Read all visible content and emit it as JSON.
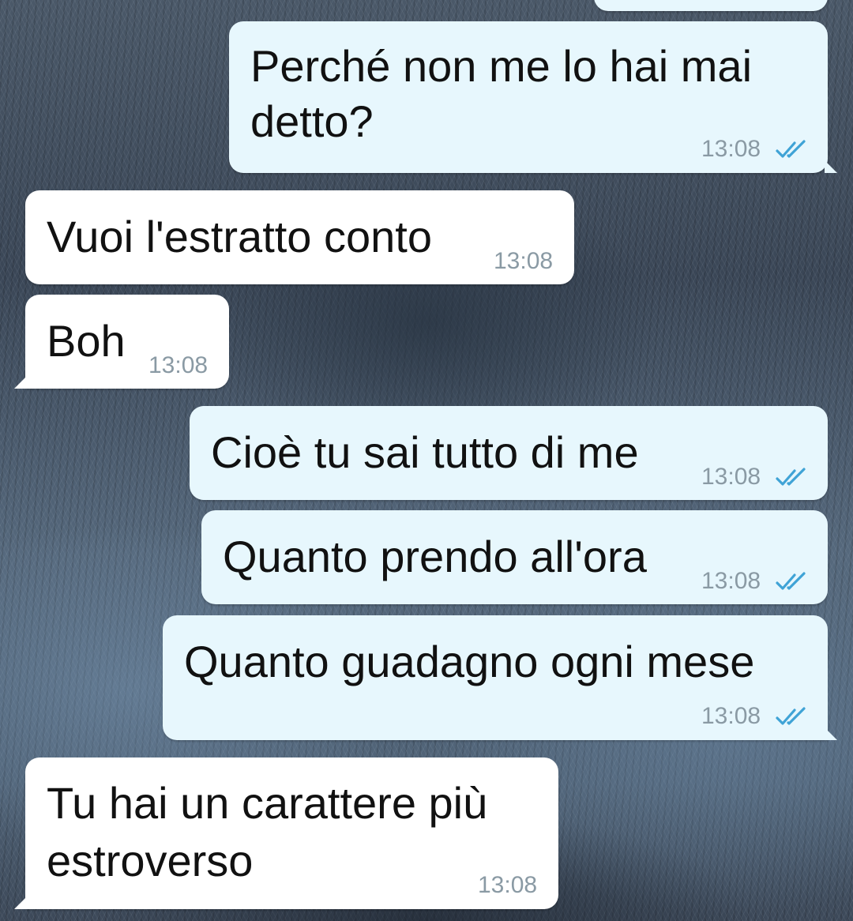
{
  "colors": {
    "outgoing_bubble": "#e7f7fd",
    "incoming_bubble": "#ffffff",
    "read_ticks": "#3fa3d6",
    "timestamp": "#8a9aa4"
  },
  "icons": {
    "read_receipt": "double-check-icon"
  },
  "messages": [
    {
      "direction": "out",
      "text_line1": "Perché non me lo hai mai",
      "text_line2": "detto?",
      "time": "13:08",
      "status": "read"
    },
    {
      "direction": "in",
      "text_line1": "Vuoi l'estratto conto",
      "time": "13:08"
    },
    {
      "direction": "in",
      "text_line1": "Boh",
      "time": "13:08"
    },
    {
      "direction": "out",
      "text_line1": "Cioè tu sai tutto di me",
      "time": "13:08",
      "status": "read"
    },
    {
      "direction": "out",
      "text_line1": "Quanto prendo all'ora",
      "time": "13:08",
      "status": "read"
    },
    {
      "direction": "out",
      "text_line1": "Quanto guadagno ogni mese",
      "time": "13:08",
      "status": "read"
    },
    {
      "direction": "in",
      "text_line1": "Tu hai un carattere più",
      "text_line2": "estroverso",
      "time": "13:08"
    }
  ]
}
